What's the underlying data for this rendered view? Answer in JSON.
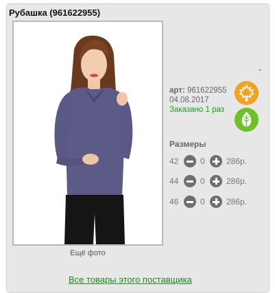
{
  "product": {
    "title": "Рубашка (961622955)",
    "more_photos": "Ещё фото",
    "article_label": "арт:",
    "article_value": "961622955",
    "date": "04.08.2017",
    "ordered": "Заказано 1 раз"
  },
  "badges": [
    {
      "icon": "maple-leaf-icon",
      "color": "#f2a21f"
    },
    {
      "icon": "leaf-icon",
      "color": "#6cc128"
    }
  ],
  "sizes": {
    "title": "Размеры",
    "rows": [
      {
        "size": "42",
        "qty": "0",
        "price": "286р."
      },
      {
        "size": "44",
        "qty": "0",
        "price": "286р."
      },
      {
        "size": "46",
        "qty": "0",
        "price": "286р."
      }
    ]
  },
  "footer": {
    "supplier_link": "Все товары этого поставщика"
  }
}
